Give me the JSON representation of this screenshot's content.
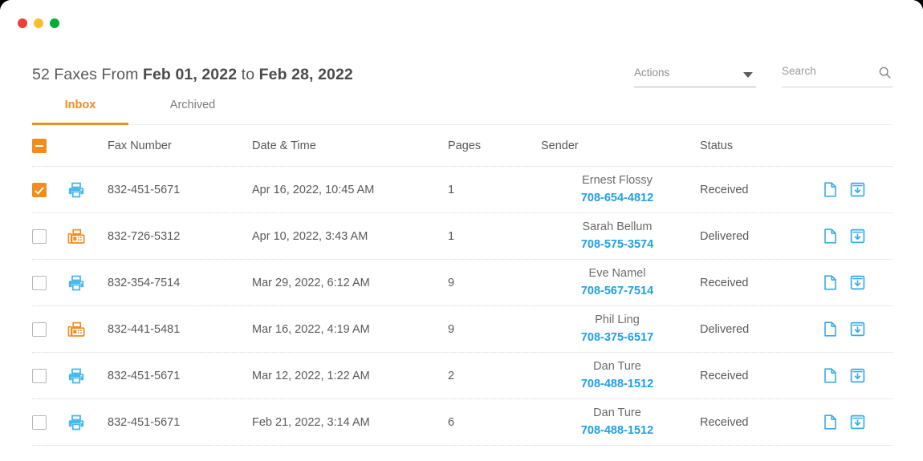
{
  "window": {
    "traffic_lights": [
      {
        "name": "close",
        "color": "#ee3e35"
      },
      {
        "name": "minimize",
        "color": "#fdbc2c"
      },
      {
        "name": "maximize",
        "color": "#00ac35"
      }
    ]
  },
  "header": {
    "count_label": "52 Faxes From ",
    "date_from": "Feb 01, 2022",
    "between_label": " to ",
    "date_to": "Feb 28, 2022"
  },
  "actions_select": {
    "label": "Actions",
    "icon": "chevron-down-icon"
  },
  "search": {
    "value": "",
    "placeholder": "Search",
    "icon": "search-icon"
  },
  "tabs": [
    {
      "label": "Inbox",
      "active": true
    },
    {
      "label": "Archived",
      "active": false
    }
  ],
  "table": {
    "select_all_state": "indeterminate",
    "columns": [
      {
        "key": "check",
        "label": ""
      },
      {
        "key": "type",
        "label": ""
      },
      {
        "key": "fax_number",
        "label": "Fax Number"
      },
      {
        "key": "date_time",
        "label": "Date & Time"
      },
      {
        "key": "pages",
        "label": "Pages"
      },
      {
        "key": "sender",
        "label": "Sender"
      },
      {
        "key": "status",
        "label": "Status"
      },
      {
        "key": "actions",
        "label": ""
      }
    ],
    "rows": [
      {
        "selected": true,
        "type_icon": "printer-icon",
        "type_color": "#4ab8ec",
        "fax_number": "832-451-5671",
        "date_time": "Apr 16, 2022, 10:45 AM",
        "pages": "1",
        "sender_name": "Ernest Flossy",
        "sender_phone": "708-654-4812",
        "status": "Received"
      },
      {
        "selected": false,
        "type_icon": "fax-machine-icon",
        "type_color": "#f28b20",
        "fax_number": "832-726-5312",
        "date_time": "Apr 10, 2022, 3:43 AM",
        "pages": "1",
        "sender_name": "Sarah Bellum",
        "sender_phone": "708-575-3574",
        "status": "Delivered"
      },
      {
        "selected": false,
        "type_icon": "printer-icon",
        "type_color": "#4ab8ec",
        "fax_number": "832-354-7514",
        "date_time": "Mar 29, 2022, 6:12 AM",
        "pages": "9",
        "sender_name": "Eve Namel",
        "sender_phone": "708-567-7514",
        "status": "Received"
      },
      {
        "selected": false,
        "type_icon": "fax-machine-icon",
        "type_color": "#f28b20",
        "fax_number": "832-441-5481",
        "date_time": "Mar 16, 2022, 4:19 AM",
        "pages": "9",
        "sender_name": "Phil Ling",
        "sender_phone": "708-375-6517",
        "status": "Delivered"
      },
      {
        "selected": false,
        "type_icon": "printer-icon",
        "type_color": "#4ab8ec",
        "fax_number": "832-451-5671",
        "date_time": "Mar 12, 2022, 1:22 AM",
        "pages": "2",
        "sender_name": "Dan Ture",
        "sender_phone": "708-488-1512",
        "status": "Received"
      },
      {
        "selected": false,
        "type_icon": "printer-icon",
        "type_color": "#4ab8ec",
        "fax_number": "832-451-5671",
        "date_time": "Feb 21, 2022, 3:14 AM",
        "pages": "6",
        "sender_name": "Dan Ture",
        "sender_phone": "708-488-1512",
        "status": "Received"
      }
    ],
    "row_actions": [
      {
        "name": "view-document-icon",
        "color": "#3aa9e8"
      },
      {
        "name": "download-icon",
        "color": "#3aa9e8"
      }
    ]
  },
  "colors": {
    "accent_orange": "#f28b20",
    "link_blue": "#1fa0e5",
    "icon_blue": "#4ab8ec",
    "text_gray": "#58595b"
  }
}
